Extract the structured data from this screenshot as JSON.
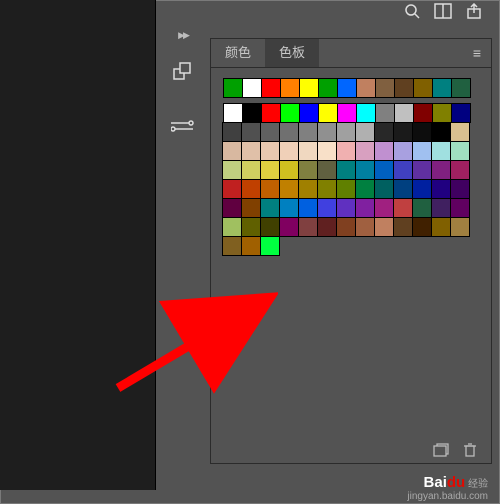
{
  "tabs": {
    "color": "颜色",
    "swatches": "色板"
  },
  "watermark": {
    "brand": "Bai",
    "brand2": "du",
    "suffix": "经验",
    "url": "jingyan.baidu.com"
  },
  "icons": {
    "search": "search-icon",
    "arrange": "arrange-icon",
    "share": "share-icon",
    "swap": "swap-colors-icon",
    "brush": "brush-icon",
    "menu": "panel-menu-icon",
    "new": "new-swatch-icon",
    "trash": "trash-icon"
  },
  "swatch_preset_row": [
    "#00a000",
    "#ffffff",
    "#ff0000",
    "#ff8000",
    "#ffff00",
    "#00a000",
    "#0066ff",
    "#c08060",
    "#806040",
    "#604020",
    "#806000",
    "#008080",
    "#206040"
  ],
  "swatch_grid": [
    "#ffffff",
    "#000000",
    "#ff0000",
    "#00ff00",
    "#0000ff",
    "#ffff00",
    "#ff00ff",
    "#00ffff",
    "#808080",
    "#c0c0c0",
    "#800000",
    "#808000",
    "#000080",
    "#404040",
    "#505050",
    "#606060",
    "#707070",
    "#808080",
    "#909090",
    "#a0a0a0",
    "#b0b0b0",
    "#282828",
    "#1a1a1a",
    "#0d0d0d",
    "#000000",
    "#d8c090",
    "#d8b8a0",
    "#e0c0a8",
    "#e8c8b0",
    "#f0d0b8",
    "#f0d8c0",
    "#f8e0c8",
    "#f0b0b0",
    "#d8a0c0",
    "#c090d0",
    "#a8a0e0",
    "#a0c0f0",
    "#a0e0e0",
    "#a0e0c0",
    "#c0d080",
    "#d0d060",
    "#e0d040",
    "#d0c020",
    "#808040",
    "#606040",
    "#008080",
    "#0080a0",
    "#0060c0",
    "#4040c0",
    "#6030a0",
    "#802080",
    "#a02060",
    "#c02020",
    "#c04000",
    "#c06000",
    "#c08000",
    "#a08000",
    "#808000",
    "#608000",
    "#008040",
    "#006060",
    "#004080",
    "#0020a0",
    "#200080",
    "#400060",
    "#600040",
    "#804000",
    "#008080",
    "#0080c0",
    "#0060e0",
    "#4040e0",
    "#6030c0",
    "#8020a0",
    "#a02080",
    "#c04040",
    "#206040",
    "#402060",
    "#600060",
    "#a0c060",
    "#606000",
    "#404000",
    "#800060",
    "#804040",
    "#602020",
    "#804020",
    "#a06040",
    "#c08060",
    "#604020",
    "#402000",
    "#806000",
    "#a08040",
    "#806020",
    "#a06000",
    "#00ff40"
  ]
}
